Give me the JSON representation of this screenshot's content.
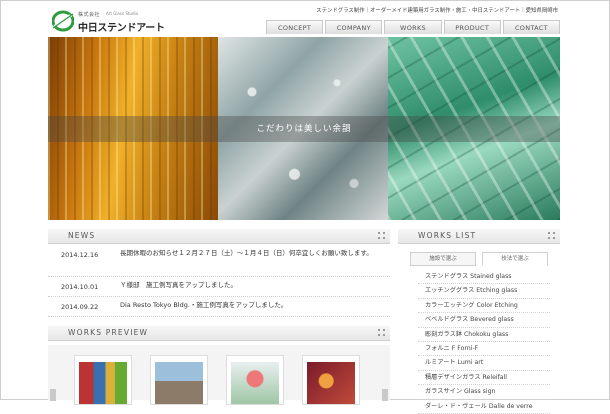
{
  "header": {
    "logo_company_type": "株式会社",
    "logo_sub": "Art Glass Studio",
    "logo_name": "中日ステンドアート",
    "tagline": "ステンドグラス制作｜オーダーメイド建築用ガラス制作・施工・中日ステンドアート｜愛知県岡崎市"
  },
  "nav": [
    "CONCEPT",
    "COMPANY",
    "WORKS",
    "PRODUCT",
    "CONTACT"
  ],
  "hero": {
    "caption": "こだわりは美しい余韻"
  },
  "news": {
    "title": "NEWS",
    "items": [
      {
        "date": "2014.12.16",
        "text": "長期休暇のお知らせ１２月２７日（土）〜１月４日（日）何卒宜しくお願い致します。"
      },
      {
        "date": "2014.10.01",
        "text": "Ｙ様邸　施工例写真をアップしました。"
      },
      {
        "date": "2014.09.22",
        "text": "Dia Resto Tokyo Bldg.・施工例写真をアップしました。"
      }
    ]
  },
  "works_preview": {
    "title": "WORKS PREVIEW"
  },
  "works_list": {
    "title": "WORKS LIST",
    "tabs": [
      "施設で選ぶ",
      "技法で選ぶ"
    ],
    "active_tab": 1,
    "items": [
      "ステンドグラス Stained glass",
      "エッチンググラス Etching glass",
      "カラーエッチング Color Etching",
      "ベベルドグラス Bevered glass",
      "彫刻ガラス鉢 Chokoku glass",
      "フォルニ F Forni-F",
      "ルミアート Lumi art",
      "積層デザインガラス Releifall",
      "ガラスサイン Glass sign",
      "ダーレ・ド・ヴェール Dalle de verre"
    ]
  },
  "colors": {
    "logo_green": "#2e9b3f",
    "accent_gray": "#555555"
  }
}
